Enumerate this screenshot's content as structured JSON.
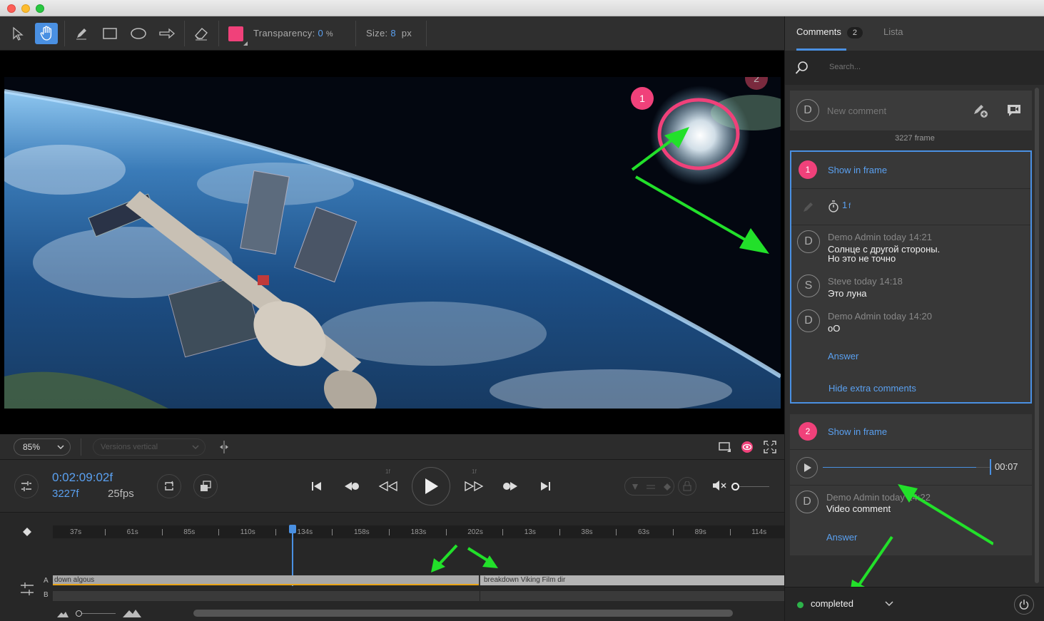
{
  "toolbar": {
    "transparency_label": "Transparency:",
    "transparency_value": "0",
    "transparency_unit": "%",
    "size_label": "Size:",
    "size_value": "8",
    "size_unit": "px",
    "color": "#f0417a"
  },
  "viewer": {
    "markers": [
      "1",
      "2"
    ]
  },
  "viewbar": {
    "zoom": "85%",
    "versions_placeholder": "Versions vertical"
  },
  "transport": {
    "timecode": "0:02:09:02f",
    "frame": "3227f",
    "fps": "25fps",
    "step_label_left": "1f",
    "step_label_right": "1f"
  },
  "timeline": {
    "ticks": [
      "37s",
      "61s",
      "85s",
      "110s",
      "134s",
      "158s",
      "183s",
      "202s",
      "13s",
      "38s",
      "63s",
      "89s",
      "114s"
    ],
    "track_a_label": "A",
    "track_b_label": "B",
    "clip1": "down algous",
    "clip2": "breakdown Viking Film dir"
  },
  "panel": {
    "tab_comments": "Comments",
    "comment_count": "2",
    "tab_list": "Lista",
    "search_placeholder": "Search...",
    "new_comment_avatar": "D",
    "new_comment_placeholder": "New comment",
    "frame_note": "3227 frame",
    "thread1": {
      "num": "1",
      "show_in_frame": "Show in frame",
      "duration": "1",
      "duration_unit": "f",
      "comments": [
        {
          "avatar": "D",
          "meta": "Demo Admin today 14:21",
          "text1": "Солнце с другой стороны.",
          "text2": "Но это не точно"
        },
        {
          "avatar": "S",
          "meta": "Steve today 14:18",
          "text1": "Это луна",
          "text2": ""
        },
        {
          "avatar": "D",
          "meta": "Demo Admin today 14:20",
          "text1": "оО",
          "text2": ""
        }
      ],
      "answer": "Answer",
      "hide_extra": "Hide extra comments"
    },
    "thread2": {
      "num": "2",
      "show_in_frame": "Show in frame",
      "audio_time": "00:07",
      "audio_progress": 0.91,
      "comment": {
        "avatar": "D",
        "meta": "Demo Admin today 14:22",
        "text": "Video comment"
      },
      "answer": "Answer"
    },
    "status": "completed",
    "status_color": "#2db34a"
  }
}
